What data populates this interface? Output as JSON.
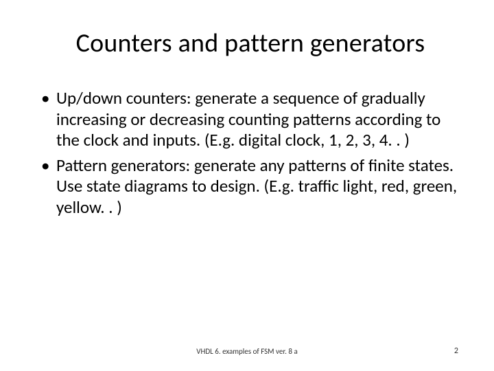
{
  "title": "Counters and pattern generators",
  "bullets": [
    "Up/down counters: generate a sequence of gradually increasing or decreasing counting patterns according to the clock and inputs. (E.g. digital clock, 1, 2, 3, 4. . )",
    "Pattern generators: generate any patterns of finite states. Use state diagrams to design. (E.g. traffic light, red, green, yellow. . )"
  ],
  "footer_center": "VHDL 6. examples of FSM ver. 8 a",
  "footer_right": "2"
}
